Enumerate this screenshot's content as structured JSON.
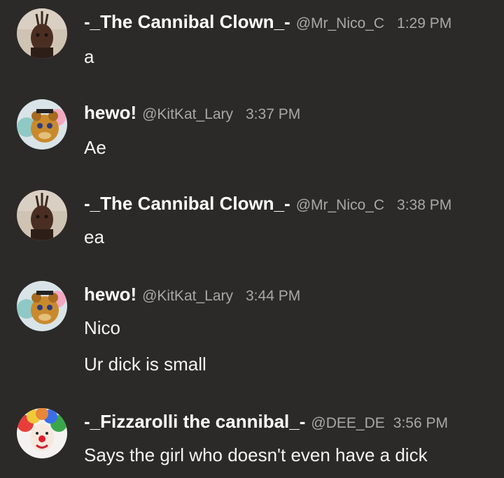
{
  "messages": [
    {
      "avatar": "deer-mask-avatar",
      "name": "-_The Cannibal Clown_-",
      "handle": "@Mr_Nico_C",
      "time": "1:29 PM",
      "lines": [
        "a"
      ]
    },
    {
      "avatar": "animatronic-bear-avatar",
      "name": "hewo!",
      "handle": "@KitKat_Lary",
      "time": "3:37 PM",
      "lines": [
        "Ae"
      ]
    },
    {
      "avatar": "deer-mask-avatar",
      "name": "-_The Cannibal Clown_-",
      "handle": "@Mr_Nico_C",
      "time": "3:38 PM",
      "lines": [
        "ea"
      ]
    },
    {
      "avatar": "animatronic-bear-avatar",
      "name": "hewo!",
      "handle": "@KitKat_Lary",
      "time": "3:44 PM",
      "lines": [
        "Nico",
        "Ur dick is small"
      ]
    },
    {
      "avatar": "clown-avatar",
      "name": "-_Fizzarolli the cannibal_-",
      "handle": "@DEE_DE",
      "time": "3:56 PM",
      "lines": [
        "Says the girl who doesn't even have a dick"
      ]
    }
  ],
  "colors": {
    "background": "#2b2a28",
    "name": "#ffffff",
    "meta": "#a9a8a6",
    "text": "#f4f4f4"
  }
}
